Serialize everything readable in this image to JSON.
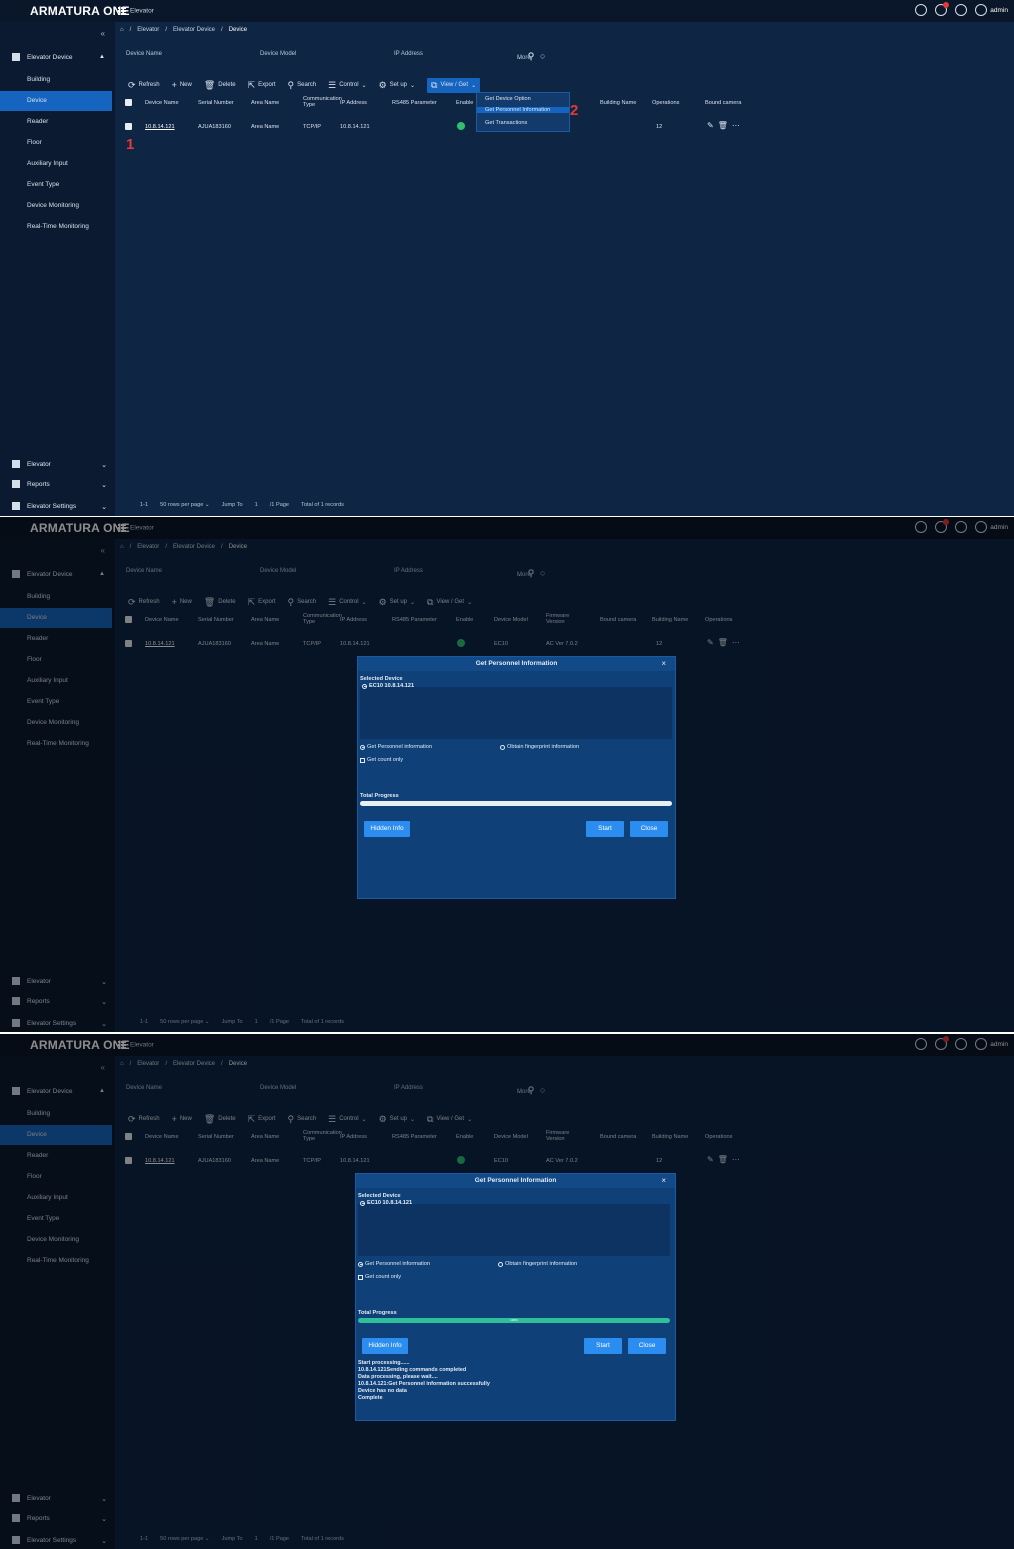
{
  "app": {
    "logo": "ARMATURA ONE",
    "module": "Elevator",
    "user": "admin"
  },
  "breadcrumb": [
    "Elevator",
    "Elevator Device",
    "Device"
  ],
  "sidebar": {
    "group": "Elevator Device",
    "items": [
      "Building",
      "Device",
      "Reader",
      "Floor",
      "Auxiliary Input",
      "Event Type",
      "Device Monitoring",
      "Real-Time Monitoring"
    ],
    "bottom": [
      "Elevator",
      "Reports",
      "Elevator Settings"
    ]
  },
  "filters": {
    "device_name": "Device Name",
    "device_model": "Device Model",
    "ip_address": "IP Address",
    "more": "More"
  },
  "toolbar": {
    "refresh": "Refresh",
    "new": "New",
    "delete": "Delete",
    "export": "Export",
    "search": "Search",
    "control": "Control",
    "setup": "Set up",
    "view_get": "View / Get"
  },
  "table": {
    "headers": [
      "Device Name",
      "Serial Number",
      "Area Name",
      "Communication Type",
      "IP Address",
      "RS485 Parameter",
      "Enable",
      "Device Model",
      "Firmware Version",
      "Bound camera",
      "Building Name",
      "Operations"
    ],
    "row": {
      "device_name": "10.8.14.121",
      "serial": "AJUA183160",
      "area": "Area Name",
      "comm": "TCP/IP",
      "ip": "10.8.14.121",
      "model": "EC10",
      "firmware": "AC Ver 7.0.2",
      "building": "12"
    }
  },
  "pager": {
    "range": "1-1",
    "per_page": "50 rows per page",
    "jump": "Jump To",
    "page": "1",
    "pages": "/1 Page",
    "total": "Total of 1 records"
  },
  "menu": {
    "items": [
      "Get Device Option",
      "Get Personnel Information",
      "Get Transactions"
    ],
    "selected": 1
  },
  "annotations": [
    "1",
    "2"
  ],
  "dialog": {
    "title": "Get Personnel Information",
    "selected_device_label": "Selected Device",
    "device": "EC10   10.8.14.121",
    "opt1": "Get Personnel information",
    "opt2": "Obtain fingerprint information",
    "count_only": "Get count only",
    "total_progress": "Total Progress",
    "hidden_info": "Hidden Info",
    "start": "Start",
    "close": "Close",
    "progress_pct": "100%",
    "log": [
      "Start processing......",
      "10.8.14.121Sending commands completed",
      "Data processing, please wait....",
      "10.8.14.121:Get Personnel information successfully",
      "Device has no data",
      "Complete"
    ]
  },
  "colors": {
    "accent": "#1565c0",
    "progress_fill": "#2fbf9a",
    "annotation": "#e53935"
  }
}
